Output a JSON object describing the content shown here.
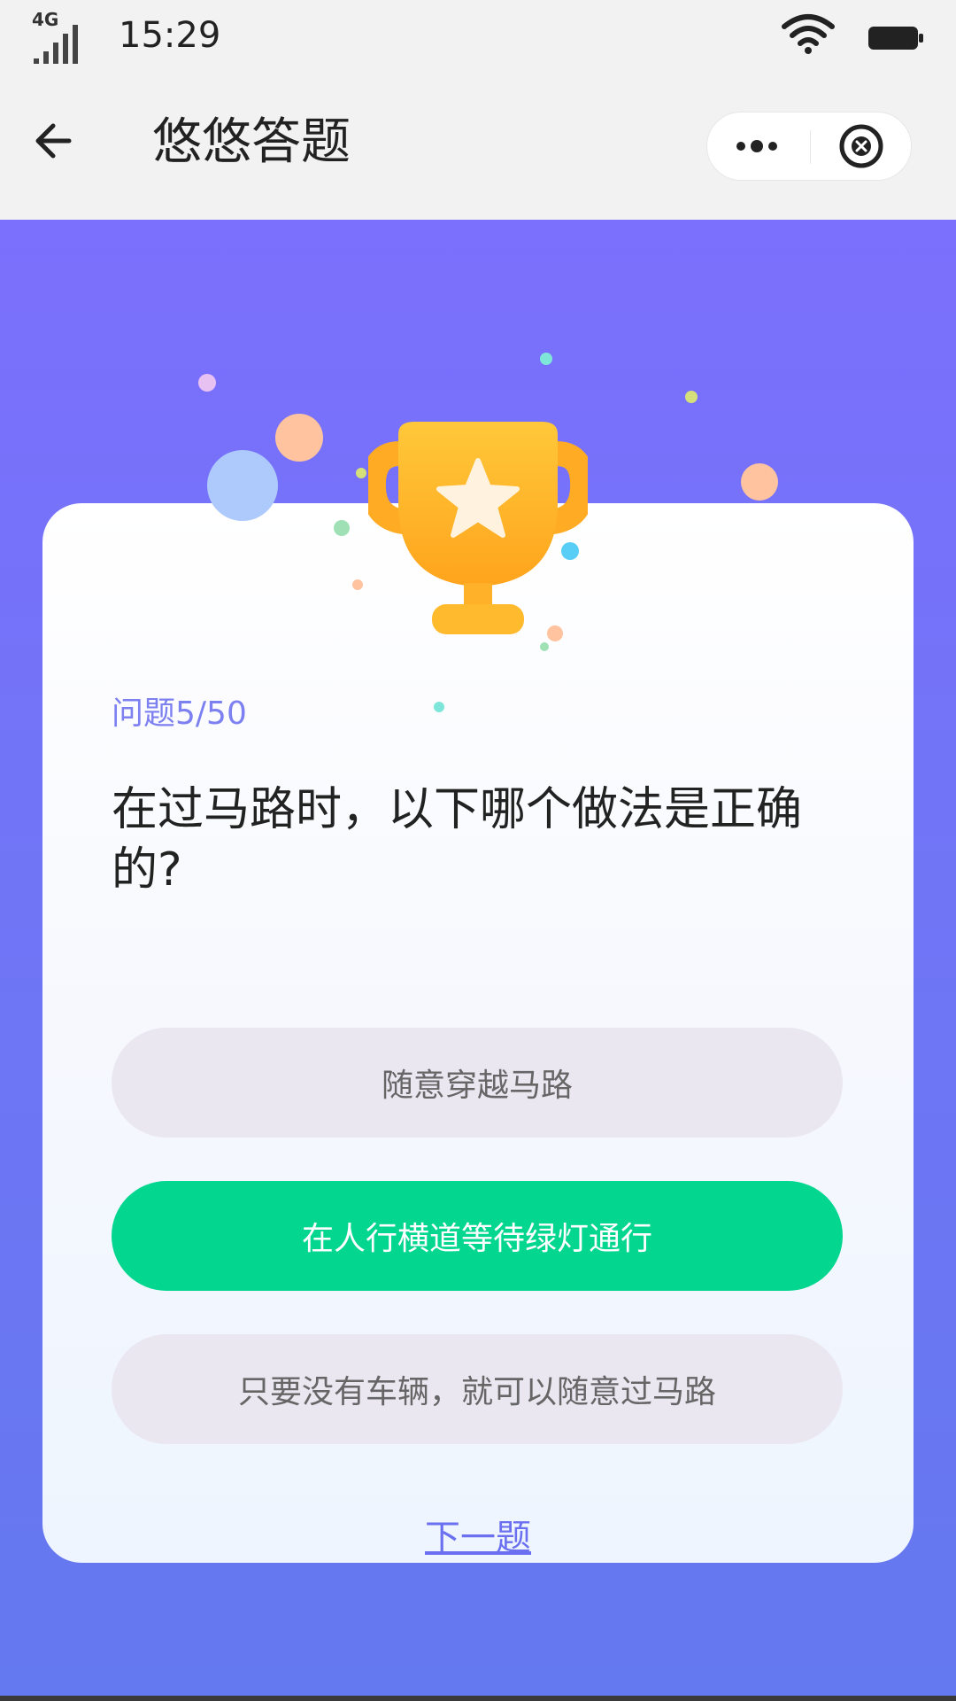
{
  "status_bar": {
    "network": "4G",
    "time": "15:29"
  },
  "nav": {
    "title": "悠悠答题"
  },
  "quiz": {
    "progress_label": "问题5/50",
    "question": "在过马路时，以下哪个做法是正确的?",
    "options": [
      {
        "label": "随意穿越马路",
        "state": "default"
      },
      {
        "label": "在人行横道等待绿灯通行",
        "state": "selected-correct"
      },
      {
        "label": "只要没有车辆，就可以随意过马路",
        "state": "default"
      }
    ],
    "next_label": "下一题"
  },
  "colors": {
    "background_top": "#7b6ffd",
    "background_bottom": "#6478ef",
    "correct": "#03d68e",
    "option_default": "#eae7f1",
    "accent_text": "#7c80f0",
    "trophy": "#ffb627"
  },
  "icons": {
    "back": "arrow-left-icon",
    "more": "more-dots-icon",
    "close": "close-circle-icon",
    "wifi": "wifi-icon",
    "battery": "battery-icon",
    "signal": "signal-icon",
    "trophy": "trophy-star-icon"
  }
}
